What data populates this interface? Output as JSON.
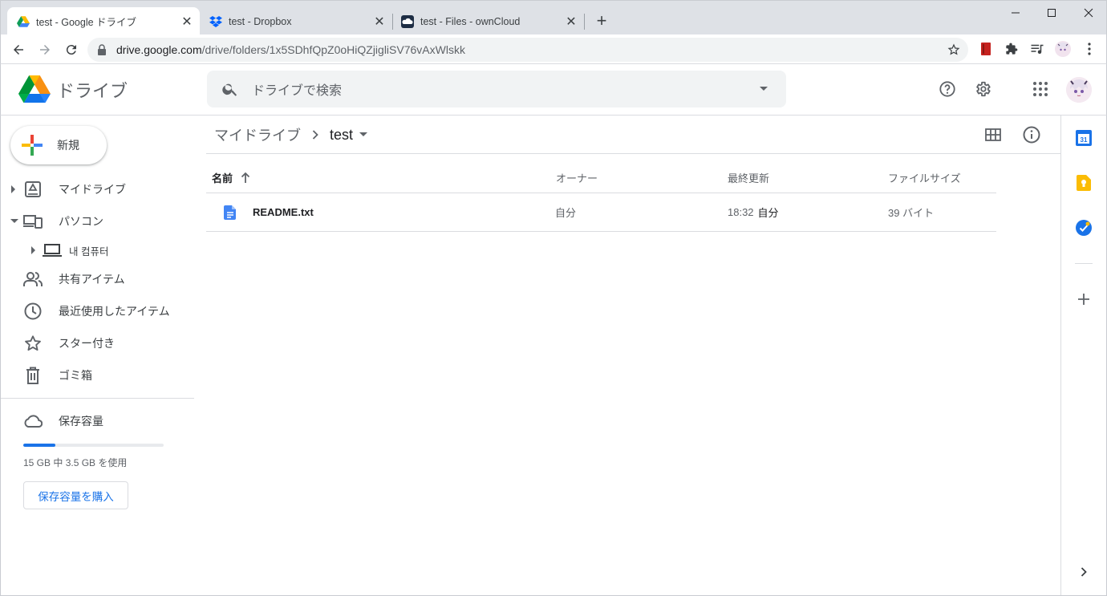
{
  "browser": {
    "tabs": [
      {
        "title": "test - Google ドライブ",
        "favicon": "google-drive-icon",
        "active": true
      },
      {
        "title": "test - Dropbox",
        "favicon": "dropbox-icon",
        "active": false
      },
      {
        "title": "test - Files - ownCloud",
        "favicon": "owncloud-icon",
        "active": false
      }
    ],
    "url_domain": "drive.google.com",
    "url_path": "/drive/folders/1x5SDhfQpZ0oHiQZjigliSV76vAxWlskk"
  },
  "header": {
    "product_name": "ドライブ",
    "search_placeholder": "ドライブで検索"
  },
  "sidebar": {
    "new_label": "新規",
    "items": [
      {
        "label": "マイドライブ",
        "icon": "my-drive-icon"
      },
      {
        "label": "パソコン",
        "icon": "computers-icon"
      },
      {
        "label": "내 컴퓨터",
        "icon": "laptop-icon"
      },
      {
        "label": "共有アイテム",
        "icon": "shared-icon"
      },
      {
        "label": "最近使用したアイテム",
        "icon": "clock-icon"
      },
      {
        "label": "スター付き",
        "icon": "star-icon"
      },
      {
        "label": "ゴミ箱",
        "icon": "trash-icon"
      }
    ],
    "storage": {
      "label": "保存容量",
      "usage_text": "15 GB 中 3.5 GB を使用",
      "used_fraction": 0.23,
      "buy_label": "保存容量を購入"
    }
  },
  "main": {
    "breadcrumb": {
      "root": "マイドライブ",
      "current": "test"
    },
    "columns": {
      "name": "名前",
      "owner": "オーナー",
      "modified": "最終更新",
      "size": "ファイルサイズ"
    },
    "files": [
      {
        "name": "README.txt",
        "owner": "自分",
        "modified_time": "18:32",
        "modified_by": "自分",
        "size": "39 バイト"
      }
    ]
  },
  "colors": {
    "accent": "#1a73e8",
    "text": "#202124",
    "muted": "#5f6368"
  }
}
